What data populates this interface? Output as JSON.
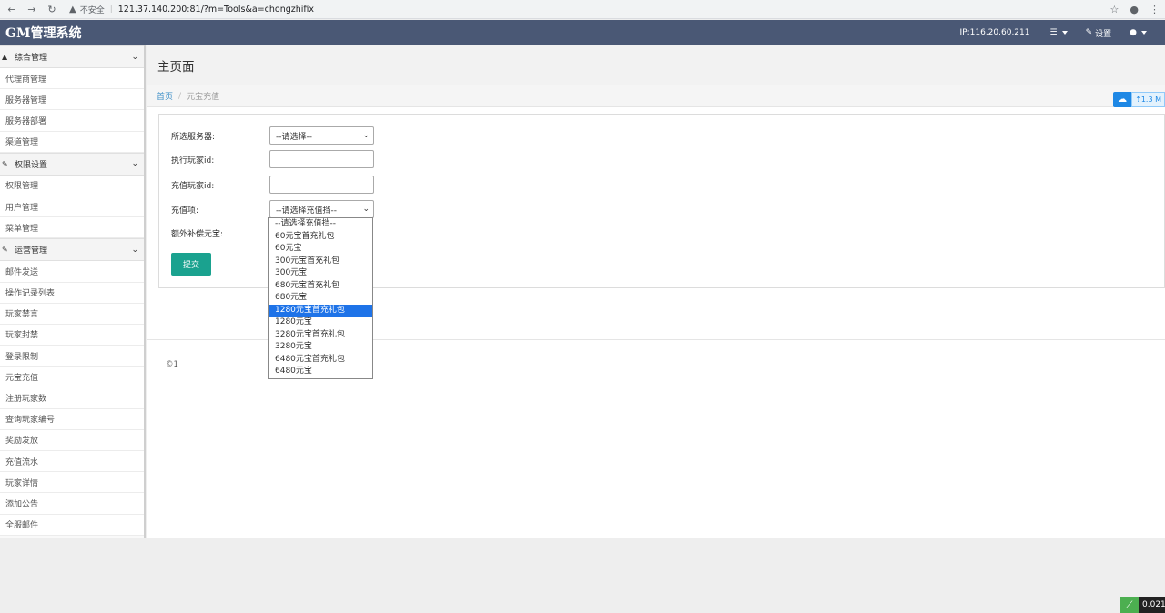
{
  "browser": {
    "insecure_label": "不安全",
    "url": "121.37.140.200:81/?m=Tools&a=chongzhifix"
  },
  "navbar": {
    "brand": "GM管理系统",
    "ip": "IP:116.20.60.211",
    "settings": "设置"
  },
  "sidebar": {
    "groups": [
      {
        "title": "综合管理",
        "items": [
          "代理商管理",
          "服务器管理",
          "服务器部署",
          "渠道管理"
        ]
      },
      {
        "title": "权限设置",
        "items": [
          "权限管理",
          "用户管理",
          "菜单管理"
        ]
      },
      {
        "title": "运营管理",
        "items": [
          "邮件发送",
          "操作记录列表",
          "玩家禁言",
          "玩家封禁",
          "登录限制",
          "元宝充值",
          "注册玩家数",
          "查询玩家编号",
          "奖励发放",
          "充值流水",
          "玩家详情",
          "添加公告",
          "全服邮件"
        ]
      }
    ]
  },
  "main": {
    "title": "主页面",
    "breadcrumb": {
      "home": "首页",
      "current": "元宝充值"
    },
    "cloud_speed": "1.3 M",
    "form": {
      "server_label": "所选服务器:",
      "server_value": "--请选择--",
      "executor_label": "执行玩家id:",
      "executor_value": "",
      "recharge_player_label": "充值玩家id:",
      "recharge_player_value": "",
      "recharge_item_label": "充值项:",
      "recharge_item_value": "--请选择充值挡--",
      "extra_label": "额外补偿元宝:",
      "submit": "提交"
    },
    "dropdown_options": [
      "--请选择充值挡--",
      "60元宝首充礼包",
      "60元宝",
      "300元宝首充礼包",
      "300元宝",
      "680元宝首充礼包",
      "680元宝",
      "1280元宝首充礼包",
      "1280元宝",
      "3280元宝首充礼包",
      "3280元宝",
      "6480元宝首充礼包",
      "6480元宝"
    ],
    "selected_option_index": 7,
    "footer": "©1"
  },
  "taskbar": {
    "value": "0.021"
  }
}
